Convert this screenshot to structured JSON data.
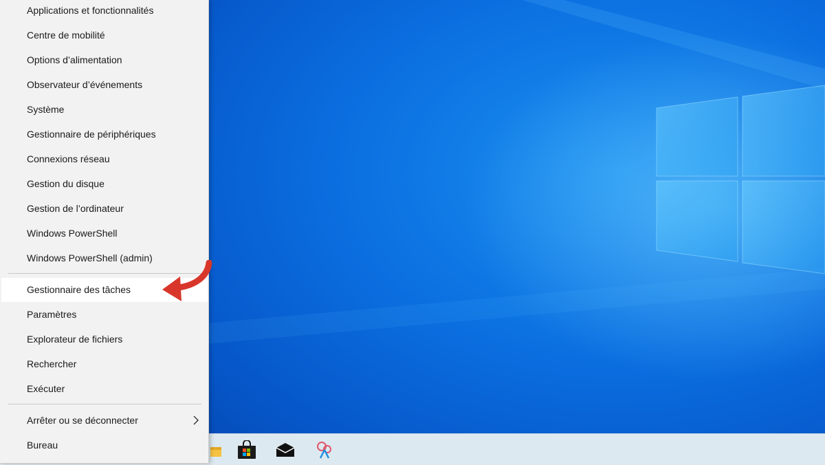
{
  "context_menu": {
    "items": [
      {
        "label": "Applications et fonctionnalités"
      },
      {
        "label": "Centre de mobilité"
      },
      {
        "label": "Options d’alimentation"
      },
      {
        "label": "Observateur d’événements"
      },
      {
        "label": "Système"
      },
      {
        "label": "Gestionnaire de périphériques"
      },
      {
        "label": "Connexions réseau"
      },
      {
        "label": "Gestion du disque"
      },
      {
        "label": "Gestion de l’ordinateur"
      },
      {
        "label": "Windows PowerShell"
      },
      {
        "label": "Windows PowerShell (admin)"
      },
      {
        "label": "Gestionnaire des tâches",
        "highlighted": true
      },
      {
        "label": "Paramètres"
      },
      {
        "label": "Explorateur de fichiers"
      },
      {
        "label": "Rechercher"
      },
      {
        "label": "Exécuter"
      },
      {
        "label": "Arrêter ou se déconnecter",
        "submenu": true
      },
      {
        "label": "Bureau"
      }
    ]
  },
  "annotation": {
    "icon": "red-curved-arrow-icon",
    "color": "#d9362b"
  },
  "taskbar": {
    "icons": [
      "file-explorer-icon",
      "store-icon",
      "mail-icon",
      "snip-sketch-icon"
    ]
  },
  "colors": {
    "desktop_blue": "#0b6fe0",
    "menu_background": "#f2f2f2",
    "highlight": "#ffffff",
    "taskbar": "#dde9f0"
  }
}
